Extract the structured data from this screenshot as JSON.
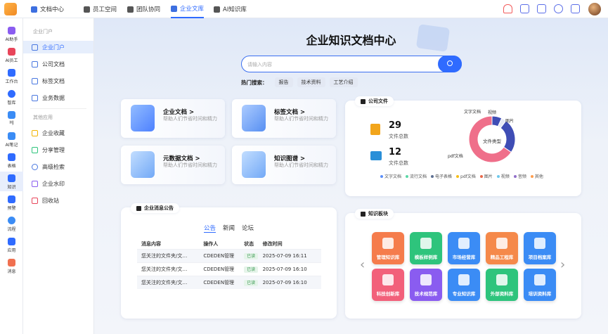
{
  "topbar": {
    "app_title": "文档中心",
    "nav": [
      "员工空间",
      "团队协同",
      "企业文库",
      "AI知识库"
    ],
    "active_nav": "企业文库"
  },
  "rail": [
    "AI助手",
    "AI员工",
    "工作台",
    "智库",
    "HJ",
    "AI笔记",
    "表格",
    "知识",
    "预警",
    "流程",
    "应用",
    "消息"
  ],
  "sidebar": {
    "group1": "企业门户",
    "items1": [
      "企业门户",
      "公司文档",
      "标签文档",
      "业务数据"
    ],
    "group2": "其他应用",
    "items2": [
      "企业收藏",
      "分享管理",
      "高级检索",
      "企业水印",
      "回收站"
    ]
  },
  "main": {
    "title": "企业知识文档中心",
    "search_placeholder": "请输入内容",
    "hot_label": "热门搜索：",
    "hot_tags": [
      "报告",
      "技术资料",
      "工艺介绍"
    ]
  },
  "quick_cards": [
    {
      "title": "企业文档 >",
      "desc": "帮助人们节省时间和精力"
    },
    {
      "title": "标签文档 >",
      "desc": "帮助人们节省时间和精力"
    },
    {
      "title": "元数据文档 >",
      "desc": "帮助人们节省时间和精力"
    },
    {
      "title": "知识图谱 >",
      "desc": "帮助人们节省时间和精力"
    }
  ],
  "company_files": {
    "title": "公司文件",
    "total_files": "29",
    "total_files_label": "文件总数",
    "total_folders": "12",
    "total_folders_label": "文件总数",
    "donut_center": "文件类型",
    "legend": [
      "文字文档",
      "流行文档",
      "电子表格",
      "pdf文档",
      "图片",
      "视频",
      "音频",
      "其他"
    ],
    "legend_colors": [
      "#5b8ff9",
      "#5ad8a6",
      "#5d7092",
      "#f6bd16",
      "#e8684a",
      "#6dc8ec",
      "#9270ca",
      "#ff9d4d"
    ]
  },
  "chart_data": {
    "type": "pie",
    "title": "文件类型",
    "categories": [
      "文字文档",
      "视频",
      "图片",
      "pdf文档"
    ],
    "values": [
      2,
      1,
      7,
      19
    ],
    "colors": [
      "#3f4db5",
      "#e6e9f5",
      "#3f4db5",
      "#ef6f8a"
    ]
  },
  "notices": {
    "title": "企业消息公告",
    "tabs": [
      "公告",
      "新闻",
      "论坛"
    ],
    "active_tab": "公告",
    "headers": [
      "消息内容",
      "操作人",
      "状态",
      "修改时间"
    ],
    "rows": [
      [
        "您关注的文件夹/文…",
        "CDEDEN管理",
        "已读",
        "2025-07-09 16:11"
      ],
      [
        "您关注的文件夹/文…",
        "CDEDEN管理",
        "已读",
        "2025-07-09 16:10"
      ],
      [
        "您关注的文件夹/文…",
        "CDEDEN管理",
        "已读",
        "2025-07-09 16:10"
      ]
    ]
  },
  "knowledge": {
    "title": "知识板块",
    "tiles": [
      {
        "label": "管理知识库",
        "color": "#f57c4c"
      },
      {
        "label": "模板样例库",
        "color": "#2ec47c"
      },
      {
        "label": "市场经营库",
        "color": "#3b8cf5"
      },
      {
        "label": "精品工程库",
        "color": "#f5894a"
      },
      {
        "label": "项目档案库",
        "color": "#3b8cf5"
      },
      {
        "label": "科技创新库",
        "color": "#f2607a"
      },
      {
        "label": "技术规范库",
        "color": "#8a5cf0"
      },
      {
        "label": "专业知识库",
        "color": "#3b8cf5"
      },
      {
        "label": "外部资料库",
        "color": "#2ec47c"
      },
      {
        "label": "培训资料库",
        "color": "#3b8cf5"
      }
    ]
  }
}
